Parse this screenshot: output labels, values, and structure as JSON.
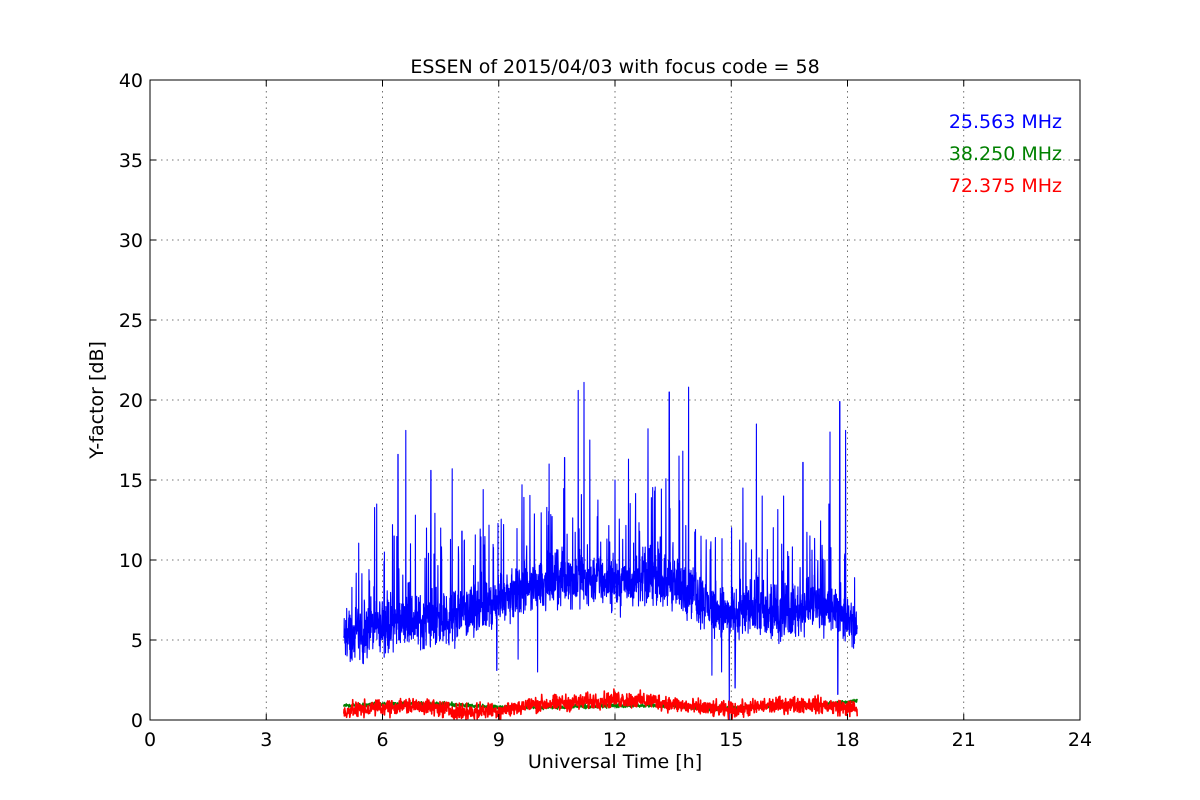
{
  "chart_data": {
    "type": "line",
    "title": "ESSEN of 2015/04/03 with focus code = 58",
    "xlabel": "Universal Time [h]",
    "ylabel": "Y-factor [dB]",
    "xlim": [
      0,
      24
    ],
    "ylim": [
      0,
      40
    ],
    "xticks": [
      0,
      3,
      6,
      9,
      12,
      15,
      18,
      21,
      24
    ],
    "yticks": [
      0,
      5,
      10,
      15,
      20,
      25,
      30,
      35,
      40
    ],
    "grid": true,
    "legend_placement": "top-right",
    "series": [
      {
        "name": "25.563 MHz",
        "color": "#0000ff",
        "baseline": [
          [
            5.0,
            5.1
          ],
          [
            5.4,
            5.2
          ],
          [
            5.8,
            5.8
          ],
          [
            6.5,
            6.2
          ],
          [
            7.5,
            6.2
          ],
          [
            8.5,
            6.8
          ],
          [
            9.0,
            7.5
          ],
          [
            10.0,
            8.5
          ],
          [
            11.0,
            9.0
          ],
          [
            12.0,
            8.5
          ],
          [
            13.0,
            9.0
          ],
          [
            14.0,
            8.0
          ],
          [
            14.5,
            7.0
          ],
          [
            15.0,
            6.5
          ],
          [
            15.5,
            7.0
          ],
          [
            16.0,
            6.5
          ],
          [
            17.0,
            7.0
          ],
          [
            17.5,
            7.0
          ],
          [
            18.0,
            6.5
          ],
          [
            18.25,
            5.5
          ]
        ],
        "noise_amplitude": 1.6,
        "spikes": [
          [
            5.65,
            9.4
          ],
          [
            5.85,
            13.5
          ],
          [
            6.05,
            10.5
          ],
          [
            6.3,
            11.5
          ],
          [
            6.4,
            16.6
          ],
          [
            6.6,
            18.1
          ],
          [
            6.85,
            12.8
          ],
          [
            7.25,
            15.6
          ],
          [
            7.5,
            12.0
          ],
          [
            7.8,
            15.7
          ],
          [
            8.05,
            11.8
          ],
          [
            8.6,
            14.4
          ],
          [
            8.95,
            13.6
          ],
          [
            9.5,
            14.3
          ],
          [
            9.6,
            14.7
          ],
          [
            10.0,
            13.0
          ],
          [
            10.3,
            16.0
          ],
          [
            10.7,
            16.4
          ],
          [
            11.05,
            20.6
          ],
          [
            11.2,
            21.1
          ],
          [
            11.35,
            17.5
          ],
          [
            12.0,
            15.0
          ],
          [
            12.35,
            16.3
          ],
          [
            12.85,
            18.2
          ],
          [
            13.4,
            20.5
          ],
          [
            13.65,
            16.5
          ],
          [
            13.75,
            16.8
          ],
          [
            13.9,
            20.8
          ],
          [
            14.5,
            18.0
          ],
          [
            15.3,
            14.5
          ],
          [
            15.65,
            18.5
          ],
          [
            15.8,
            14.0
          ],
          [
            16.35,
            14.0
          ],
          [
            16.85,
            16.1
          ],
          [
            17.55,
            18.0
          ],
          [
            17.8,
            19.9
          ],
          [
            17.95,
            18.1
          ]
        ],
        "dips": [
          [
            6.15,
            4.2
          ],
          [
            8.95,
            3.1
          ],
          [
            9.5,
            3.8
          ],
          [
            10.0,
            3.0
          ],
          [
            14.5,
            2.8
          ],
          [
            14.75,
            3.0
          ],
          [
            14.95,
            0.0
          ],
          [
            15.1,
            2.0
          ],
          [
            17.75,
            1.6
          ]
        ]
      },
      {
        "name": "38.250 MHz",
        "color": "#008000",
        "baseline": [
          [
            5.0,
            0.9
          ],
          [
            6.0,
            1.0
          ],
          [
            7.5,
            1.0
          ],
          [
            9.0,
            0.8
          ],
          [
            10.5,
            0.8
          ],
          [
            12.0,
            0.9
          ],
          [
            13.5,
            0.9
          ],
          [
            14.5,
            0.7
          ],
          [
            15.5,
            0.8
          ],
          [
            16.5,
            0.9
          ],
          [
            17.5,
            1.0
          ],
          [
            18.25,
            1.2
          ]
        ],
        "noise_amplitude": 0.12,
        "spikes": [],
        "dips": []
      },
      {
        "name": "72.375 MHz",
        "color": "#ff0000",
        "baseline": [
          [
            5.0,
            0.55
          ],
          [
            6.0,
            0.8
          ],
          [
            7.0,
            0.9
          ],
          [
            8.0,
            0.5
          ],
          [
            9.0,
            0.6
          ],
          [
            10.0,
            1.0
          ],
          [
            11.0,
            1.1
          ],
          [
            12.0,
            1.3
          ],
          [
            13.0,
            1.2
          ],
          [
            14.0,
            0.8
          ],
          [
            15.0,
            0.6
          ],
          [
            16.0,
            0.9
          ],
          [
            17.0,
            1.0
          ],
          [
            18.25,
            0.7
          ]
        ],
        "noise_amplitude": 0.5,
        "spikes": [],
        "dips": []
      }
    ]
  }
}
